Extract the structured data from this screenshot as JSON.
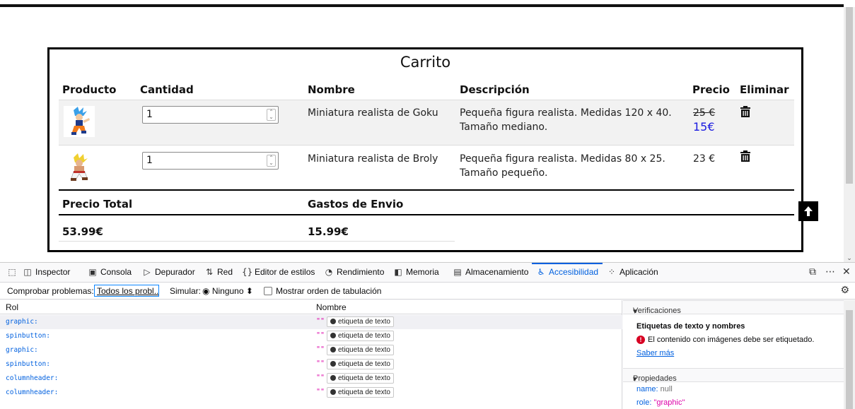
{
  "cart": {
    "title": "Carrito",
    "headers": {
      "producto": "Producto",
      "cantidad": "Cantidad",
      "nombre": "Nombre",
      "descripcion": "Descripción",
      "precio": "Precio",
      "eliminar": "Eliminar"
    },
    "items": [
      {
        "quantity": "1",
        "name": "Miniatura realista de Goku",
        "desc1": "Pequeña figura realista. Medidas 120 x 40.",
        "desc2": "Tamaño mediano.",
        "old_price": "25 €",
        "new_price": "15€",
        "delete_icon": "trash-icon",
        "image": "goku-figure"
      },
      {
        "quantity": "1",
        "name": "Miniatura realista de Broly",
        "desc1": "Pequeña figura realista. Medidas 80 x 25.",
        "desc2": "Tamaño pequeño.",
        "price": "23 €",
        "delete_icon": "trash-icon",
        "image": "broly-figure"
      }
    ],
    "totals": {
      "total_label": "Precio Total",
      "shipping_label": "Gastos de Envio",
      "total_value": "53.99€",
      "shipping_value": "15.99€"
    },
    "scroll_top_icon": "arrow-up-icon",
    "new_price_color": "#1a1ae0"
  },
  "devtools": {
    "tabs": [
      "Inspector",
      "Consola",
      "Depurador",
      "Red",
      "Editor de estilos",
      "Rendimiento",
      "Memoria",
      "Almacenamiento",
      "Accesibilidad",
      "Aplicación"
    ],
    "active_tab": "Accesibilidad",
    "toolbar": {
      "check_label": "Comprobar problemas:",
      "check_value": "Todos los probl...",
      "simulate_label": "Simular:",
      "simulate_value": "Ninguno",
      "tab_order_label": "Mostrar orden de tabulación"
    },
    "tree": {
      "col_role": "Rol",
      "col_name": "Nombre",
      "rows": [
        {
          "role": "graphic:",
          "name": "\"\"",
          "badge": "etiqueta de texto"
        },
        {
          "role": "spinbutton:",
          "name": "\"\"",
          "badge": "etiqueta de texto"
        },
        {
          "role": "graphic:",
          "name": "\"\"",
          "badge": "etiqueta de texto"
        },
        {
          "role": "spinbutton:",
          "name": "\"\"",
          "badge": "etiqueta de texto"
        },
        {
          "role": "columnheader:",
          "name": "\"\"",
          "badge": "etiqueta de texto"
        },
        {
          "role": "columnheader:",
          "name": "\"\"",
          "badge": "etiqueta de texto"
        }
      ]
    },
    "sidebar": {
      "checks_title": "Verificaciones",
      "checks_heading": "Etiquetas de texto y nombres",
      "checks_error": "El contenido con imágenes debe ser etiquetado.",
      "learn_more": "Saber más",
      "props_title": "Propiedades",
      "prop_name_key": "name:",
      "prop_name_val": "null",
      "prop_role_key": "role:",
      "prop_role_val": "\"graphic\""
    },
    "accent_color": "#0060df"
  }
}
